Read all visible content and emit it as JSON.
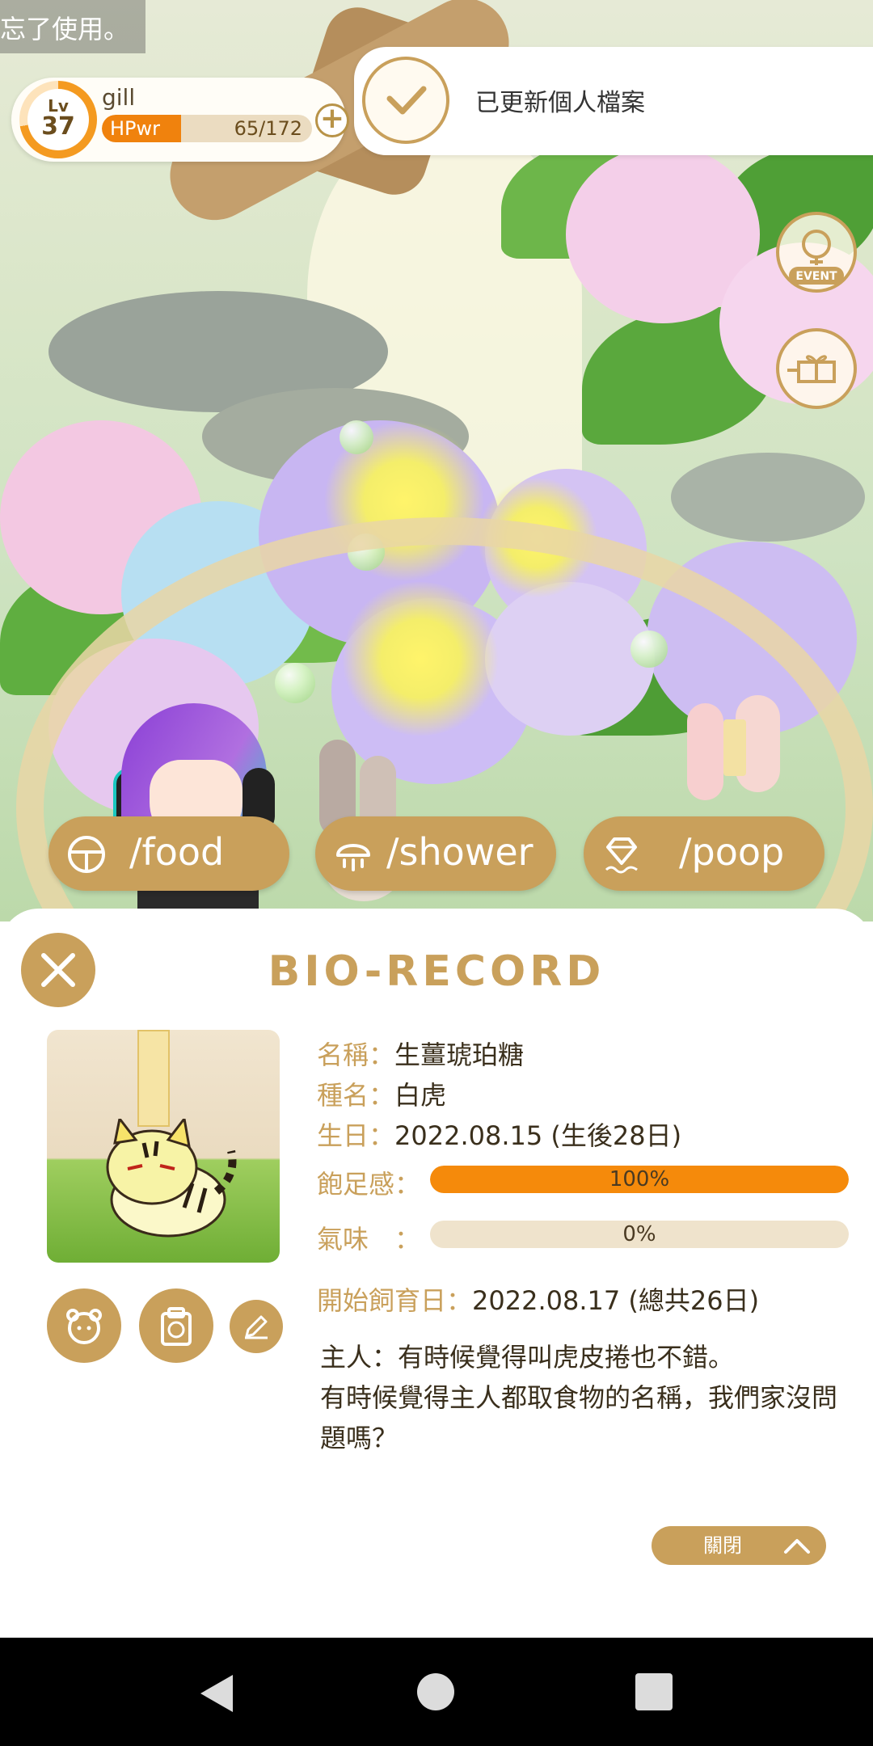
{
  "toast": {
    "text": "忘了使用。"
  },
  "player": {
    "level_label": "Lv",
    "level": "37",
    "name": "gill",
    "hp_label": "HPwr",
    "hp_value": "65/172",
    "hp_fraction": 0.378
  },
  "banner": {
    "text": "已更新個人檔案"
  },
  "side_buttons": {
    "event_label": "EVENT"
  },
  "actions": [
    {
      "label": "/food",
      "icon": "food-bowl-icon"
    },
    {
      "label": "/shower",
      "icon": "shower-icon"
    },
    {
      "label": "/poop",
      "icon": "diamond-poop-icon"
    }
  ],
  "panel": {
    "title": "BIO-RECORD",
    "name_label": "名稱：",
    "name_value": "生薑琥珀糖",
    "species_label": "種名：",
    "species_value": "白虎",
    "birthday_label": "生日：",
    "birthday_value": "2022.08.15 (生後28日)",
    "fullness_label": "飽足感：",
    "fullness_value": "100%",
    "fullness_fraction": 1.0,
    "smell_label": "氣味　：",
    "smell_value": "0%",
    "smell_fraction": 0.0,
    "start_label": "開始飼育日：",
    "start_value": "2022.08.17 (總共26日)",
    "owner_note_line1": "主人：有時候覺得叫虎皮捲也不錯。",
    "owner_note_line2": "有時候覺得主人都取食物的名稱，我們家沒問題嗎？",
    "collapse_label": "關閉"
  },
  "colors": {
    "accent_gold": "#c9a05b",
    "hp_orange": "#f0820d",
    "meter_orange": "#f58a0b"
  }
}
